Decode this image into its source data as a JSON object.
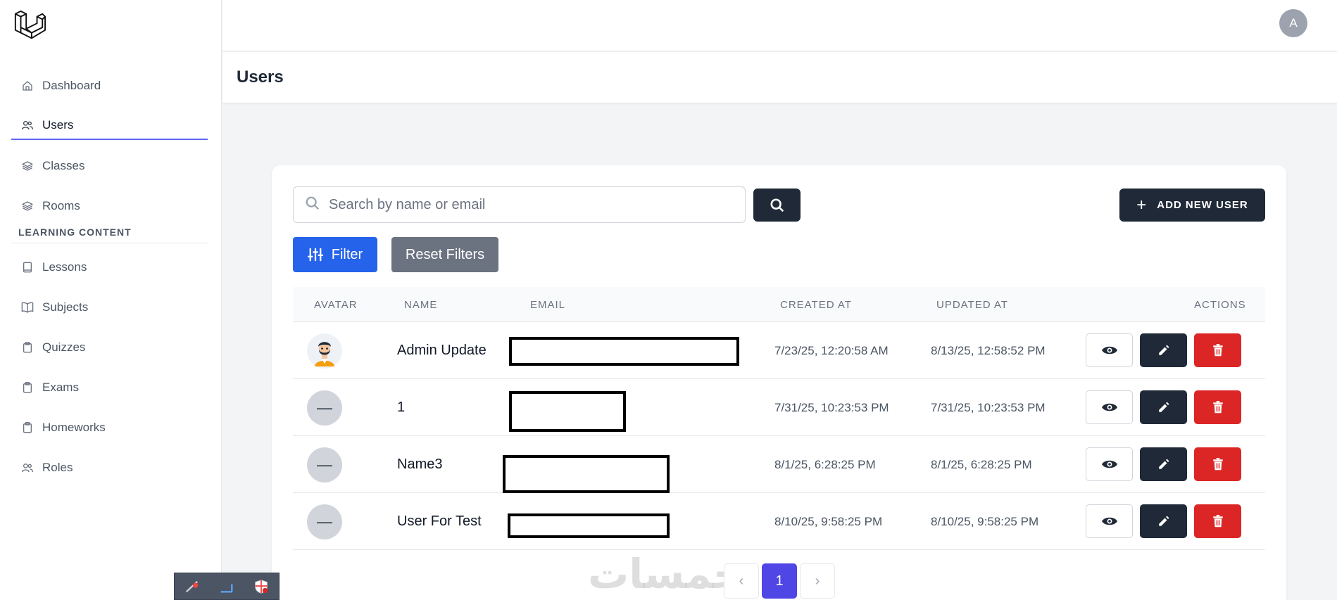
{
  "sidebar": {
    "items": [
      {
        "label": "Dashboard",
        "icon": "home-icon"
      },
      {
        "label": "Users",
        "icon": "users-icon"
      },
      {
        "label": "Classes",
        "icon": "layers-icon"
      },
      {
        "label": "Rooms",
        "icon": "layers-icon"
      }
    ],
    "section_title": "LEARNING CONTENT",
    "content_items": [
      {
        "label": "Lessons",
        "icon": "book-icon"
      },
      {
        "label": "Subjects",
        "icon": "open-book-icon"
      },
      {
        "label": "Quizzes",
        "icon": "clipboard-icon"
      },
      {
        "label": "Exams",
        "icon": "clipboard-icon"
      },
      {
        "label": "Homeworks",
        "icon": "clipboard-icon"
      },
      {
        "label": "Roles",
        "icon": "users-icon"
      }
    ]
  },
  "header": {
    "avatar_initial": "A"
  },
  "page": {
    "title": "Users"
  },
  "toolbar": {
    "search_placeholder": "Search by name or email",
    "add_label": "ADD NEW USER",
    "filter_label": "Filter",
    "reset_label": "Reset Filters"
  },
  "table": {
    "columns": [
      "AVATAR",
      "NAME",
      "EMAIL",
      "CREATED AT",
      "UPDATED AT",
      "ACTIONS"
    ],
    "rows": [
      {
        "avatar": "",
        "name": "Admin Update",
        "created": "7/23/25, 12:20:58 AM",
        "updated": "8/13/25, 12:58:52 PM"
      },
      {
        "avatar": "—",
        "name": "1",
        "created": "7/31/25, 10:23:53 PM",
        "updated": "7/31/25, 10:23:53 PM"
      },
      {
        "avatar": "—",
        "name": "Name3",
        "created": "8/1/25, 6:28:25 PM",
        "updated": "8/1/25, 6:28:25 PM"
      },
      {
        "avatar": "—",
        "name": "User For Test",
        "created": "8/10/25, 9:58:25 PM",
        "updated": "8/10/25, 9:58:25 PM"
      }
    ]
  },
  "pagination": {
    "prev": "‹",
    "current": "1",
    "next": "›"
  },
  "watermark": "خمسات",
  "colors": {
    "primary_dark": "#1f2937",
    "filter_blue": "#2563eb",
    "delete_red": "#dc2626",
    "page_active": "#4f46e5",
    "nav_active_underline": "#6366f1"
  }
}
